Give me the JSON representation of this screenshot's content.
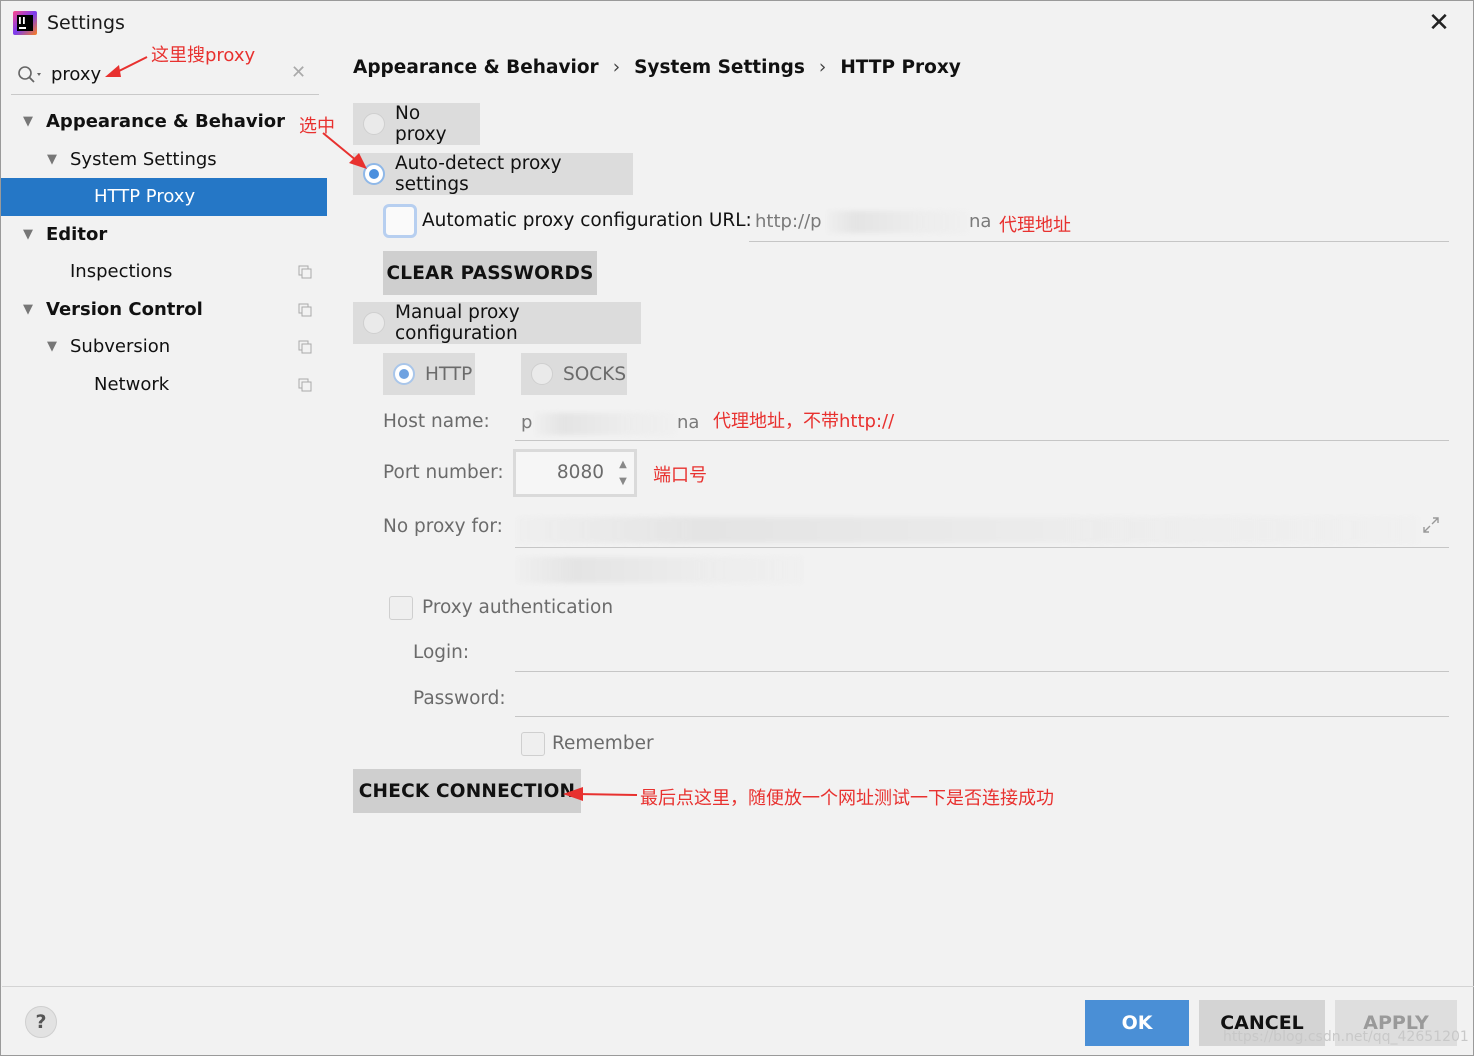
{
  "window": {
    "title": "Settings"
  },
  "search": {
    "value": "proxy"
  },
  "sidebar": {
    "items": [
      {
        "label": "Appearance & Behavior"
      },
      {
        "label": "System Settings"
      },
      {
        "label": "HTTP Proxy"
      },
      {
        "label": "Editor"
      },
      {
        "label": "Inspections"
      },
      {
        "label": "Version Control"
      },
      {
        "label": "Subversion"
      },
      {
        "label": "Network"
      }
    ]
  },
  "breadcrumb": [
    "Appearance & Behavior",
    "System Settings",
    "HTTP Proxy"
  ],
  "proxy": {
    "no_proxy": "No proxy",
    "auto_detect": "Auto-detect proxy settings",
    "auto_url_label": "Automatic proxy configuration URL:",
    "auto_url_value": "http://p",
    "auto_url_tail": "na",
    "clear_passwords": "CLEAR PASSWORDS",
    "manual": "Manual proxy configuration",
    "http": "HTTP",
    "socks": "SOCKS",
    "host_label": "Host name:",
    "host_value": "p",
    "host_tail": "na",
    "port_label": "Port number:",
    "port_value": "8080",
    "no_proxy_for_label": "No proxy for:",
    "proxy_auth": "Proxy authentication",
    "login_label": "Login:",
    "password_label": "Password:",
    "remember": "Remember",
    "check_connection": "CHECK CONNECTION"
  },
  "annotations": {
    "search_hint": "这里搜proxy",
    "select_hint": "选中",
    "auto_url_hint": "代理地址",
    "host_hint": "代理地址，不带http://",
    "port_hint": "端口号",
    "check_hint": "最后点这里，随便放一个网址测试一下是否连接成功"
  },
  "footer": {
    "help": "?",
    "ok": "OK",
    "cancel": "CANCEL",
    "apply": "APPLY",
    "watermark": "https://blog.csdn.net/qq_42651201"
  },
  "colors": {
    "selection": "#2577c6",
    "ok_button": "#4a8fd6",
    "annotation": "#e8312f"
  }
}
